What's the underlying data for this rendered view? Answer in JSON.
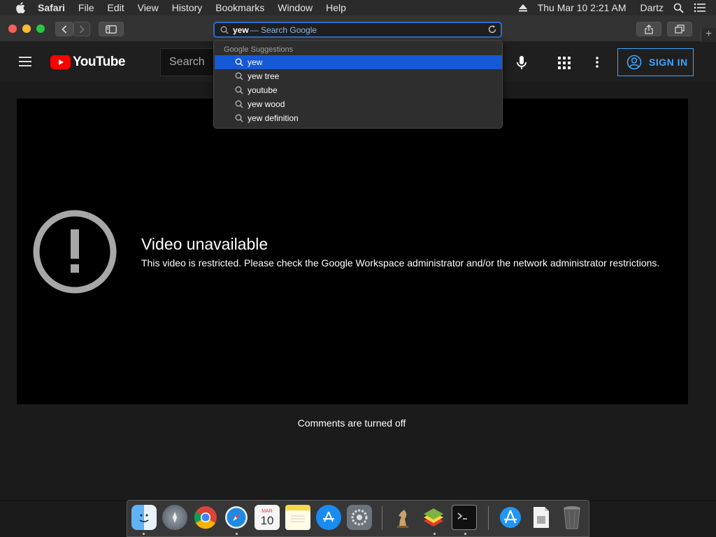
{
  "menubar": {
    "app": "Safari",
    "items": [
      "File",
      "Edit",
      "View",
      "History",
      "Bookmarks",
      "Window",
      "Help"
    ],
    "clock": "Thu Mar 10  2:21 AM",
    "user": "Dartz"
  },
  "address_bar": {
    "query": "yew",
    "hint": "— Search Google"
  },
  "suggestions": {
    "header": "Google Suggestions",
    "items": [
      "yew",
      "yew tree",
      "youtube",
      "yew wood",
      "yew definition"
    ],
    "selected_index": 0
  },
  "youtube": {
    "logo_text": "YouTube",
    "search_placeholder": "Search",
    "sign_in": "SIGN IN",
    "video_title": "Video unavailable",
    "video_message": "This video is restricted. Please check the Google Workspace administrator and/or the network administrator restrictions.",
    "comments": "Comments are turned off"
  },
  "dock": {
    "calendar_month": "MAR",
    "calendar_day": "10",
    "items": [
      "finder-icon",
      "launchpad-icon",
      "chrome-icon",
      "safari-icon",
      "calendar-icon",
      "notes-icon",
      "app-store-icon",
      "system-preferences-icon",
      "chess-icon",
      "bluestacks-icon",
      "terminal-icon",
      "downloads-folder-icon",
      "document-icon",
      "trash-icon"
    ]
  },
  "colors": {
    "youtube_red": "#ff0000",
    "accent_blue": "#3ea6ff",
    "selection_blue": "#1659d6"
  }
}
